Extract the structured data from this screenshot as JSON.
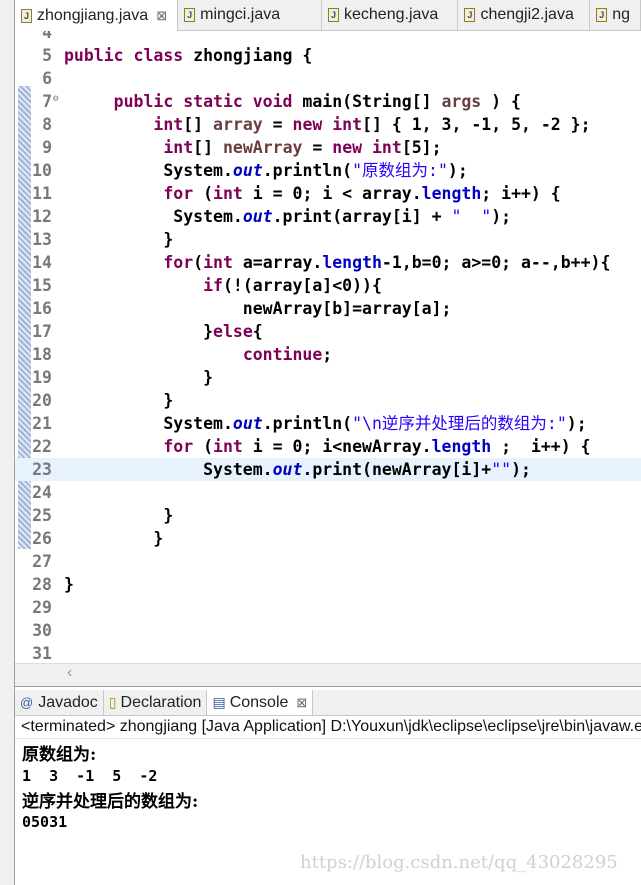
{
  "tabs": [
    {
      "label": "zhongjiang.java",
      "active": true
    },
    {
      "label": "mingci.java"
    },
    {
      "label": "kecheng.java"
    },
    {
      "label": "chengji2.java"
    },
    {
      "label": "ng"
    }
  ],
  "colors": {
    "keyword": "#7f0055",
    "string": "#2a00ff",
    "field": "#0000c0",
    "current_line": "#e8f2fe"
  },
  "editor": {
    "current_line": 23,
    "lines": [
      {
        "n": "4",
        "t": []
      },
      {
        "n": "5",
        "t": [
          [
            "k",
            "public class "
          ],
          [
            "p",
            "zhongjiang {"
          ]
        ]
      },
      {
        "n": "6",
        "t": []
      },
      {
        "n": "7",
        "fold": true,
        "t": [
          [
            "p",
            "     "
          ],
          [
            "k",
            "public static void "
          ],
          [
            "p",
            "main(String[] "
          ],
          [
            "v",
            "args"
          ],
          [
            "p",
            " ) {"
          ]
        ]
      },
      {
        "n": "8",
        "t": [
          [
            "p",
            "         "
          ],
          [
            "k",
            "int"
          ],
          [
            "p",
            "[] "
          ],
          [
            "v",
            "array"
          ],
          [
            "p",
            " = "
          ],
          [
            "k",
            "new int"
          ],
          [
            "p",
            "[] { 1, 3, -1, 5, -2 };"
          ]
        ]
      },
      {
        "n": "9",
        "t": [
          [
            "p",
            "          "
          ],
          [
            "k",
            "int"
          ],
          [
            "p",
            "[] "
          ],
          [
            "v",
            "newArray"
          ],
          [
            "p",
            " = "
          ],
          [
            "k",
            "new int"
          ],
          [
            "p",
            "[5];"
          ]
        ]
      },
      {
        "n": "10",
        "t": [
          [
            "p",
            "          System."
          ],
          [
            "f",
            "out"
          ],
          [
            "p",
            ".println("
          ],
          [
            "s",
            "\"原数组为:\""
          ],
          [
            "p",
            ");"
          ]
        ]
      },
      {
        "n": "11",
        "t": [
          [
            "p",
            "          "
          ],
          [
            "k",
            "for"
          ],
          [
            "p",
            " ("
          ],
          [
            "k",
            "int"
          ],
          [
            "p",
            " i = 0; i < array."
          ],
          [
            "fl",
            "length"
          ],
          [
            "p",
            "; i++) {"
          ]
        ]
      },
      {
        "n": "12",
        "t": [
          [
            "p",
            "           System."
          ],
          [
            "f",
            "out"
          ],
          [
            "p",
            ".print(array[i] + "
          ],
          [
            "s",
            "\"  \""
          ],
          [
            "p",
            ");"
          ]
        ]
      },
      {
        "n": "13",
        "t": [
          [
            "p",
            "          }"
          ]
        ]
      },
      {
        "n": "14",
        "t": [
          [
            "p",
            "          "
          ],
          [
            "k",
            "for"
          ],
          [
            "p",
            "("
          ],
          [
            "k",
            "int"
          ],
          [
            "p",
            " a=array."
          ],
          [
            "fl",
            "length"
          ],
          [
            "p",
            "-1,b=0; a>=0; a--,b++){"
          ]
        ]
      },
      {
        "n": "15",
        "t": [
          [
            "p",
            "              "
          ],
          [
            "k",
            "if"
          ],
          [
            "p",
            "(!(array[a]<0)){"
          ]
        ]
      },
      {
        "n": "16",
        "t": [
          [
            "p",
            "                  newArray[b]=array[a];"
          ]
        ]
      },
      {
        "n": "17",
        "t": [
          [
            "p",
            "              }"
          ],
          [
            "k",
            "else"
          ],
          [
            "p",
            "{"
          ]
        ]
      },
      {
        "n": "18",
        "t": [
          [
            "p",
            "                  "
          ],
          [
            "k",
            "continue"
          ],
          [
            "p",
            ";"
          ]
        ]
      },
      {
        "n": "19",
        "t": [
          [
            "p",
            "              }"
          ]
        ]
      },
      {
        "n": "20",
        "t": [
          [
            "p",
            "          }"
          ]
        ]
      },
      {
        "n": "21",
        "t": [
          [
            "p",
            "          System."
          ],
          [
            "f",
            "out"
          ],
          [
            "p",
            ".println("
          ],
          [
            "s",
            "\"\\n逆序并处理后的数组为:\""
          ],
          [
            "p",
            ");"
          ]
        ]
      },
      {
        "n": "22",
        "t": [
          [
            "p",
            "          "
          ],
          [
            "k",
            "for"
          ],
          [
            "p",
            " ("
          ],
          [
            "k",
            "int"
          ],
          [
            "p",
            " i = 0; i<newArray."
          ],
          [
            "fl",
            "length"
          ],
          [
            "p",
            " ;  i++) {"
          ]
        ]
      },
      {
        "n": "23",
        "t": [
          [
            "p",
            "              System."
          ],
          [
            "f",
            "out"
          ],
          [
            "p",
            ".print(newArray[i]+"
          ],
          [
            "s",
            "\"\""
          ],
          [
            "p",
            ");"
          ]
        ]
      },
      {
        "n": "24",
        "t": []
      },
      {
        "n": "25",
        "t": [
          [
            "p",
            "          }"
          ]
        ]
      },
      {
        "n": "26",
        "t": [
          [
            "p",
            "         }"
          ]
        ]
      },
      {
        "n": "27",
        "t": []
      },
      {
        "n": "28",
        "t": [
          [
            "p",
            "}"
          ]
        ]
      },
      {
        "n": "29",
        "t": []
      },
      {
        "n": "30",
        "t": []
      },
      {
        "n": "31",
        "t": []
      }
    ]
  },
  "bottom_tabs": [
    {
      "label": "Javadoc",
      "icon": "at-icon"
    },
    {
      "label": "Declaration",
      "icon": "declaration-icon"
    },
    {
      "label": "Console",
      "icon": "console-icon",
      "active": true
    }
  ],
  "console": {
    "header": "<terminated> zhongjiang [Java Application] D:\\Youxun\\jdk\\eclipse\\eclipse\\jre\\bin\\javaw.exe",
    "output": [
      "原数组为:",
      "1  3  -1  5  -2",
      "逆序并处理后的数组为:",
      "05031"
    ]
  },
  "watermark": "https://blog.csdn.net/qq_43028295"
}
